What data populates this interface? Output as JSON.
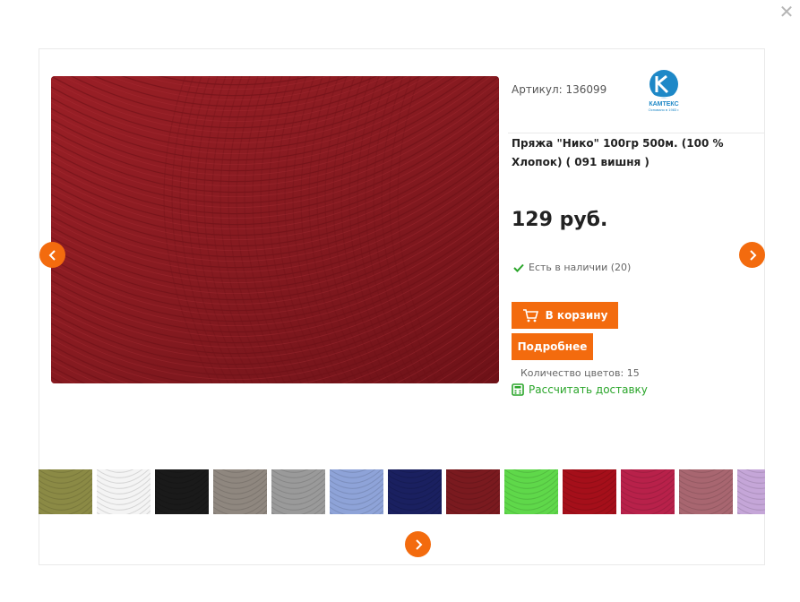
{
  "dialog": {
    "close_icon": "close-icon"
  },
  "product": {
    "article": "Артикул: 136099",
    "title": "Пряжа \"Нико\" 100гр 500м. (100 % Хлопок)  ( 091 вишня )",
    "price": "129 руб.",
    "stock": "Есть в наличии (20)",
    "colors_count": "Количество цветов: 15",
    "image_color": "#8b1a1f"
  },
  "brand": {
    "logo_text": "КАМТЕКС",
    "logo_subtext": "Основано в 1983 г.",
    "logo_color": "#1e88c7"
  },
  "actions": {
    "cart_label": "В корзину",
    "more_label": "Подробнее",
    "delivery_label": "Рассчитать доставку"
  },
  "colors": {
    "accent": "#f36b0e",
    "success": "#2aa52a"
  },
  "swatches": [
    {
      "color": "#8b8a45"
    },
    {
      "color": "#f4f4f4"
    },
    {
      "color": "#1a1a1a"
    },
    {
      "color": "#8f877f"
    },
    {
      "color": "#9a9a9a"
    },
    {
      "color": "#8ea3d8"
    },
    {
      "color": "#1a2060"
    },
    {
      "color": "#7a1a1f"
    },
    {
      "color": "#5fd84a"
    },
    {
      "color": "#a50f1a"
    },
    {
      "color": "#b8214a"
    },
    {
      "color": "#a86670"
    },
    {
      "color": "#c5a6d8"
    }
  ]
}
